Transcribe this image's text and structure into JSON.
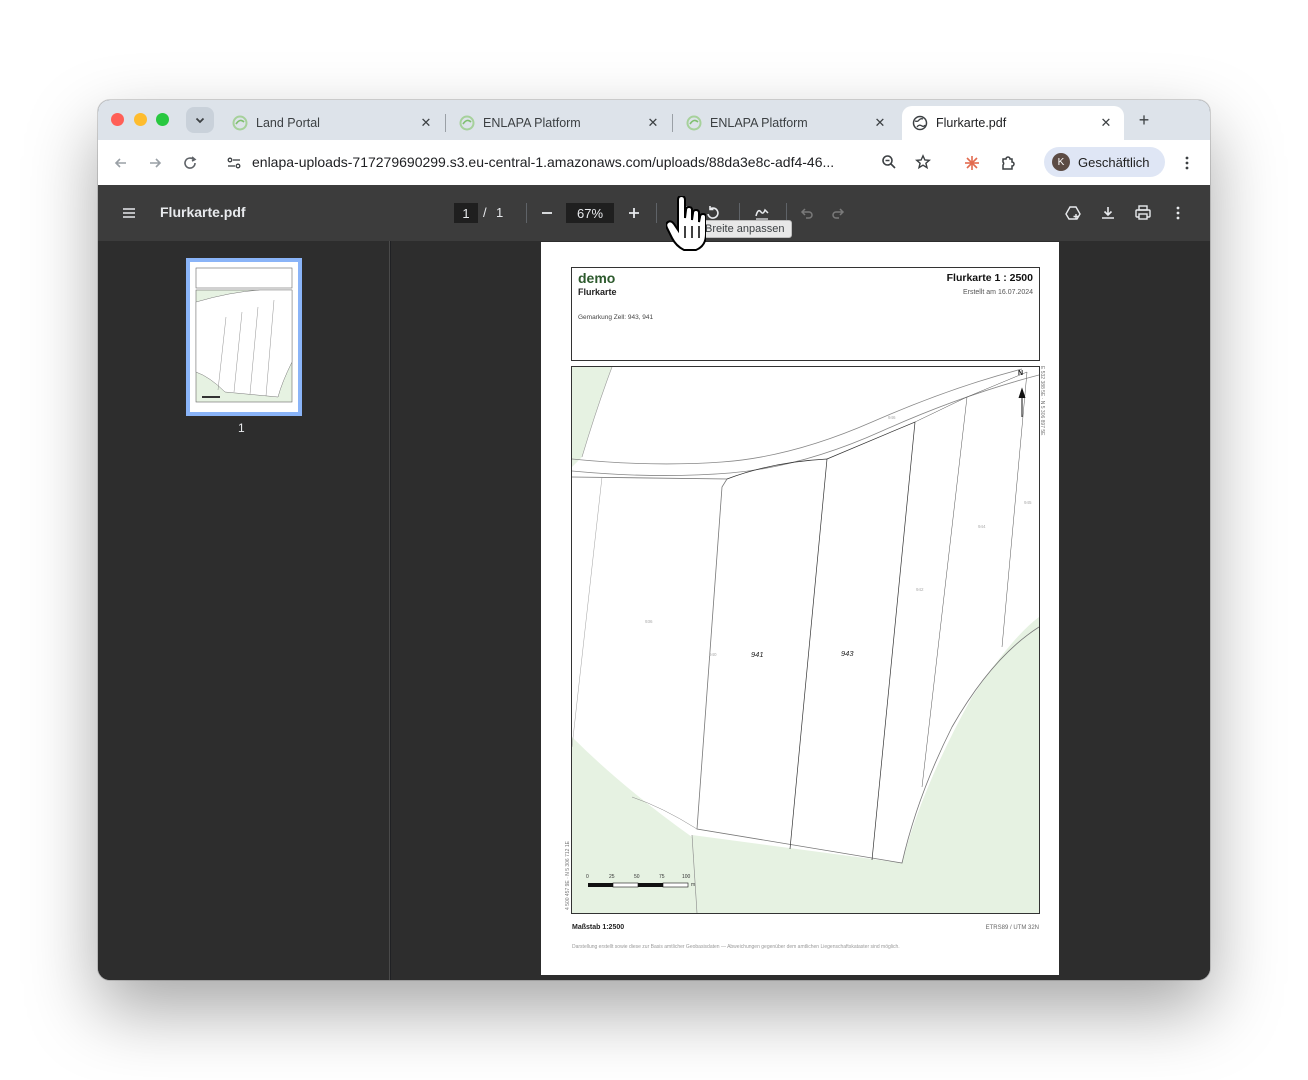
{
  "browser": {
    "tabs": [
      {
        "label": "Land Portal",
        "favicon": "enlapa-icon",
        "active": false
      },
      {
        "label": "ENLAPA Platform",
        "favicon": "enlapa-icon",
        "active": false
      },
      {
        "label": "ENLAPA Platform",
        "favicon": "enlapa-icon",
        "active": false
      },
      {
        "label": "Flurkarte.pdf",
        "favicon": "globe-icon",
        "active": true
      }
    ],
    "url": "enlapa-uploads-717279690299.s3.eu-central-1.amazonaws.com/uploads/88da3e8c-adf4-46...",
    "profile_label": "Geschäftlich",
    "profile_initial": "K"
  },
  "pdf_viewer": {
    "file_name": "Flurkarte.pdf",
    "current_page": "1",
    "page_separator": "/",
    "total_pages": "1",
    "zoom": "67%",
    "tooltip": "Breite anpassen",
    "thumbnail_page_number": "1"
  },
  "document": {
    "org": "demo",
    "subtitle": "Flurkarte",
    "title": "Flurkarte 1 : 2500",
    "created": "Erstellt am 16.07.2024",
    "gemarkung": "Gemarkung Zell: 943, 941",
    "scale_label": "Maßstab 1:2500",
    "crs": "ETRS89 / UTM 32N",
    "footnote": "Darstellung erstellt sowie diese zur Basis amtlicher Geobasisdaten — Abweichungen gegenüber dem amtlichen Liegenschaftskataster sind möglich.",
    "north_label": "N",
    "coord_left": "4 500 457 9E · N 5 306 712 1E",
    "coord_right": "E 532 388 5E · N 5 306 897 5E",
    "parcels": [
      "941",
      "943"
    ],
    "minor_parcels": [
      "936",
      "940",
      "942",
      "944",
      "945",
      "946"
    ],
    "scalebar": {
      "ticks": [
        "0",
        "25",
        "50",
        "75",
        "100"
      ],
      "unit": "m"
    }
  },
  "colors": {
    "accent": "#8ab4f8",
    "field_green": "#e6f2e2",
    "toolbar": "#3c3c3c"
  }
}
